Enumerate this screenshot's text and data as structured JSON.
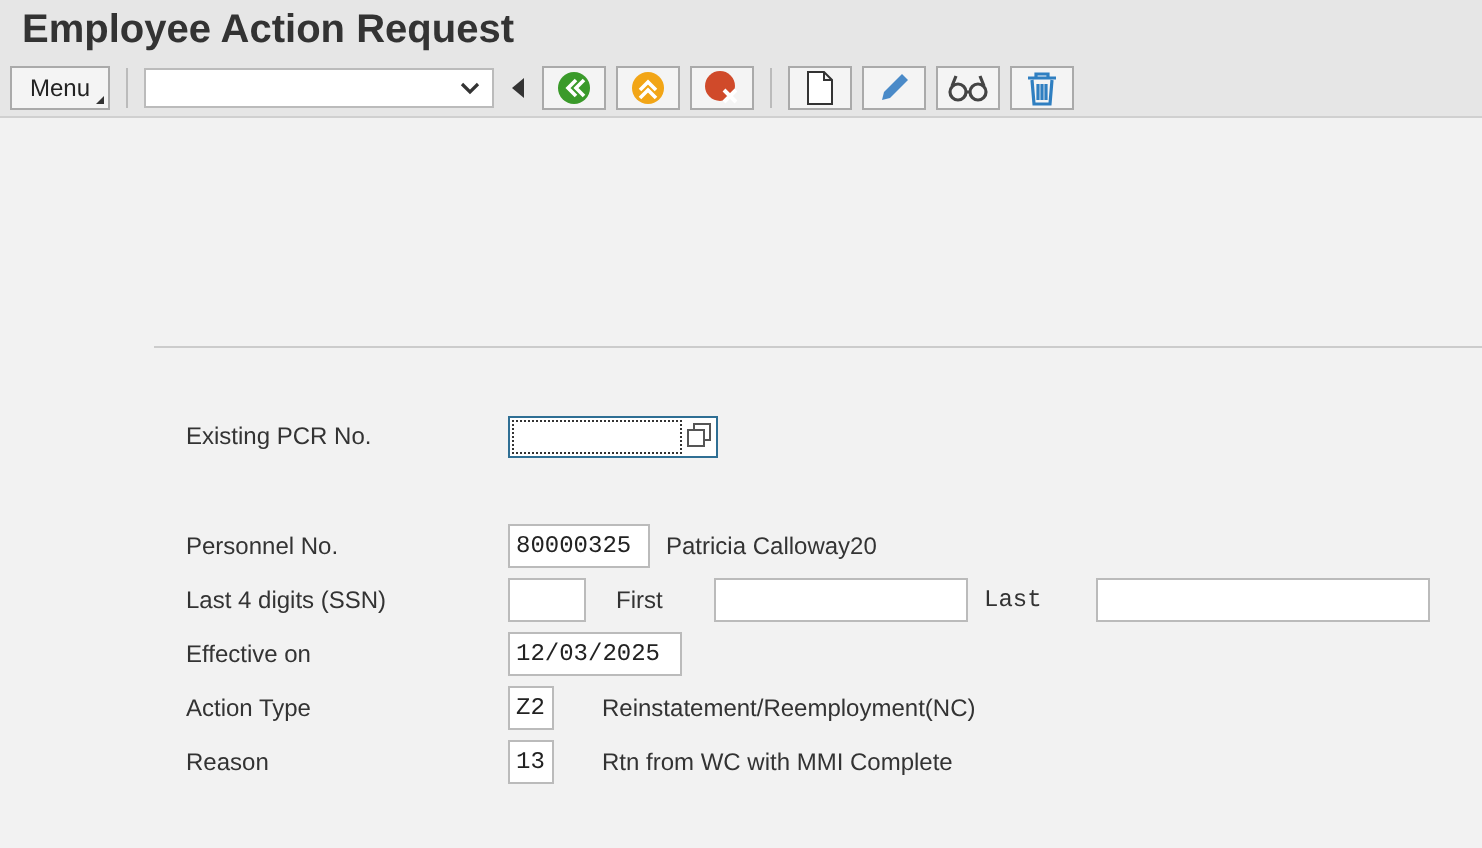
{
  "window": {
    "title": "Employee Action Request"
  },
  "toolbar": {
    "menu_button": "Menu"
  },
  "existing_pcr": {
    "label": "Existing PCR No."
  },
  "personnel": {
    "label": "Personnel No.",
    "value": "80000325",
    "name": "Patricia Calloway20"
  },
  "ssn": {
    "label": "Last 4 digits (SSN)",
    "first_label": "First",
    "last_label": "Last"
  },
  "effective": {
    "label": "Effective on",
    "value": "12/03/2025"
  },
  "action_type": {
    "label": "Action Type",
    "value": "Z2",
    "description": "Reinstatement/Reemployment(NC)"
  },
  "reason": {
    "label": "Reason",
    "value": "13",
    "description": "Rtn from WC with MMI Complete"
  }
}
